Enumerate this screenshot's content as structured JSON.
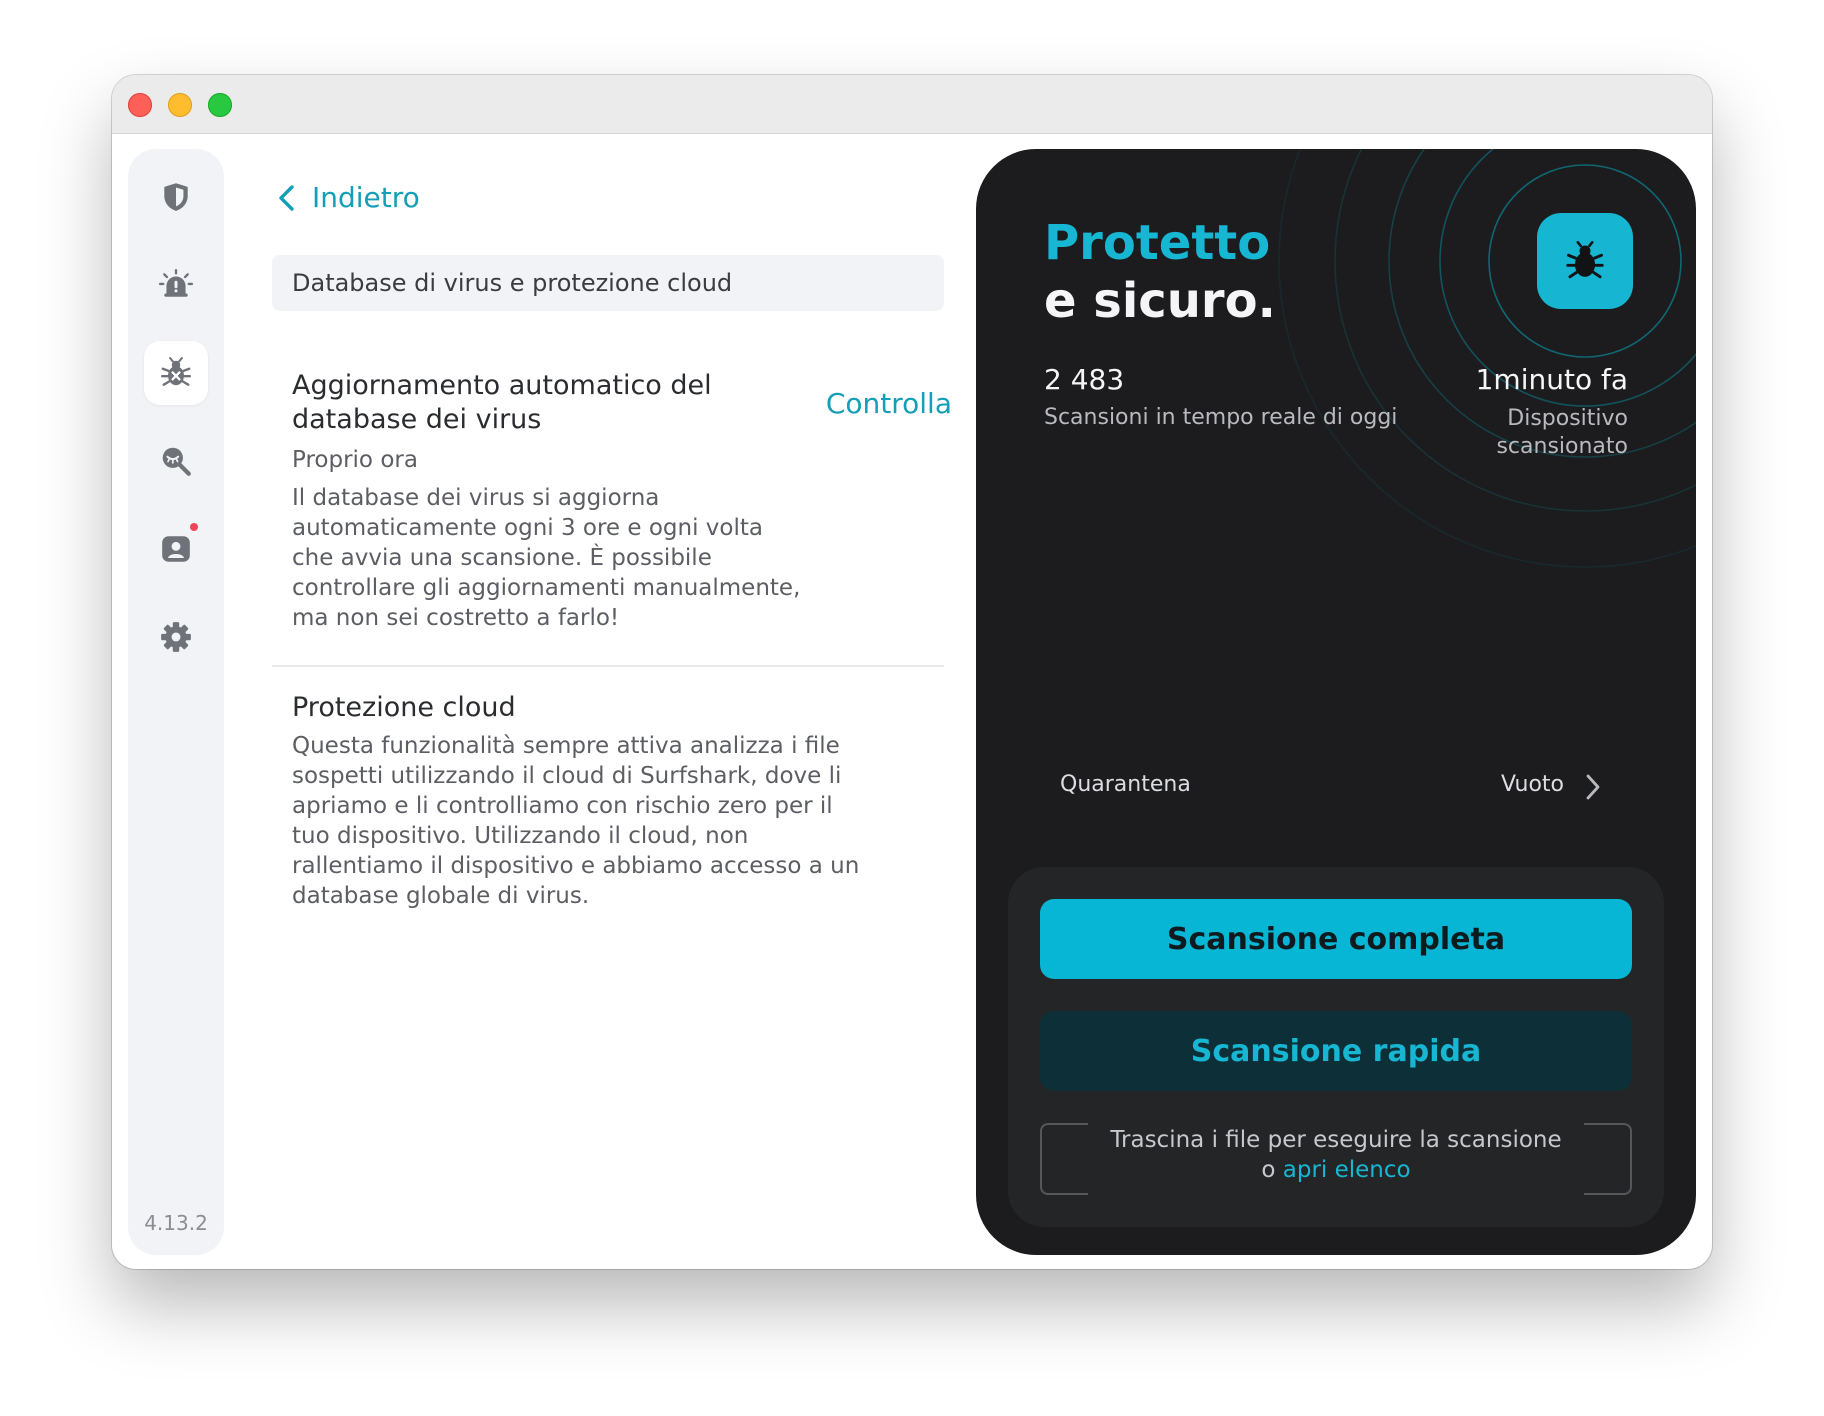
{
  "window": {
    "traffic_lights": [
      "close",
      "minimize",
      "zoom"
    ]
  },
  "sidebar": {
    "items": [
      {
        "icon": "shield-icon"
      },
      {
        "icon": "alert-bug-icon"
      },
      {
        "icon": "bug-scan-icon",
        "active": true
      },
      {
        "icon": "search-icon"
      },
      {
        "icon": "user-alert-icon",
        "notification": true
      },
      {
        "icon": "gear-icon"
      }
    ],
    "version": "4.13.2"
  },
  "main": {
    "back_label": "Indietro",
    "section_header": "Database di virus e protezione cloud",
    "update_block": {
      "title_line1": "Aggiornamento automatico del",
      "title_line2": "database dei virus",
      "action": "Controlla",
      "subtitle": "Proprio ora",
      "desc_lines": [
        "Il database dei virus si aggiorna",
        "automaticamente ogni 3 ore e ogni volta",
        "che avvia una scansione. È possibile",
        "controllare gli aggiornamenti manualmente,",
        "ma non sei costretto a farlo!"
      ]
    },
    "cloud_block": {
      "title": "Protezione cloud",
      "desc_lines": [
        "Questa funzionalità sempre attiva analizza i file",
        "sospetti utilizzando il cloud di Surfshark, dove li",
        "apriamo e li controlliamo con rischio zero per il",
        "tuo dispositivo. Utilizzando il cloud, non",
        "rallentiamo il dispositivo e abbiamo accesso a un",
        "database globale di virus."
      ]
    }
  },
  "panel": {
    "status_line1": "Protetto",
    "status_line2": "e sicuro.",
    "scans_count": "2 483",
    "scans_label": "Scansioni in tempo reale di oggi",
    "last_scan_time": "1minuto fa",
    "last_scan_label_line1": "Dispositivo",
    "last_scan_label_line2": "scansionato",
    "quarantine_label": "Quarantena",
    "quarantine_value": "Vuoto",
    "full_scan": "Scansione completa",
    "quick_scan": "Scansione rapida",
    "drop_text": "Trascina i file per eseguire la scansione",
    "drop_or": "o",
    "drop_link": "apri elenco"
  },
  "colors": {
    "accent": "#17b6d3",
    "panel_bg": "#1c1c1e",
    "full_scan_bg": "#06b6d4",
    "quick_scan_bg": "#0d3038",
    "notification": "#f0445a"
  }
}
